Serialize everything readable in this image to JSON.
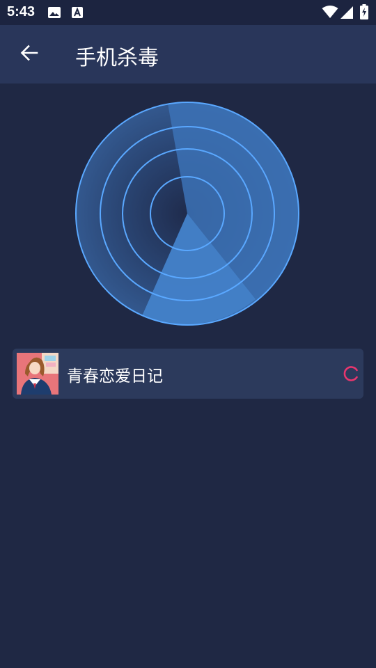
{
  "status_bar": {
    "time": "5:43",
    "left_icons": [
      "image-icon",
      "text-a-icon"
    ],
    "right_icons": [
      "wifi-icon",
      "cell-signal-icon",
      "battery-charging-icon"
    ]
  },
  "app_bar": {
    "back_icon": "arrow-left-icon",
    "title": "手机杀毒"
  },
  "scanner": {
    "state": "scanning",
    "colors": {
      "ring": "#5aa8ff",
      "sweep": "#3f7fc8",
      "background": "#1f2844"
    }
  },
  "scan_item": {
    "app_name": "青春恋爱日记",
    "status_icon": "loading-spinner-icon",
    "spinner_color": "#e8366e"
  }
}
